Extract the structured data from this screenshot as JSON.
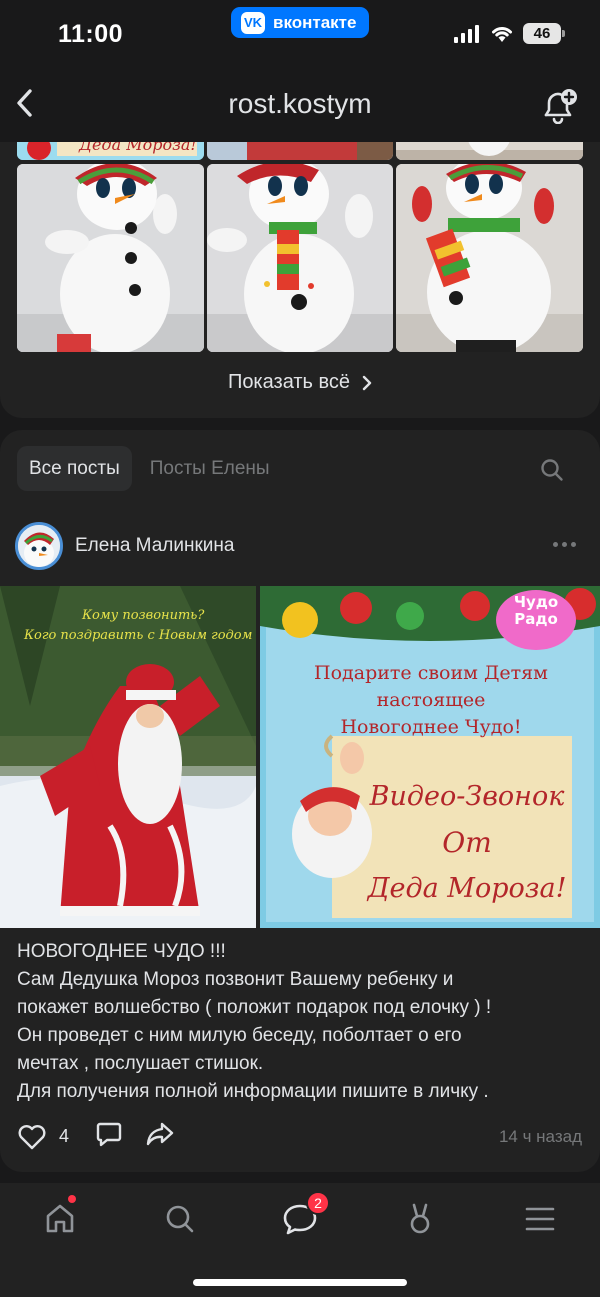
{
  "status_bar": {
    "time": "11:00",
    "app_pill_logo": "VK",
    "app_pill_label": "вконтакте",
    "battery": "46"
  },
  "header": {
    "title": "rost.kostym",
    "back_icon": "chevron-left-icon",
    "notify_icon": "bell-plus-icon"
  },
  "gallery": {
    "strip_caption": "Деда Мороза!",
    "show_all_label": "Показать всё",
    "show_all_icon": "chevron-right-icon"
  },
  "posts": {
    "tabs": [
      {
        "label": "Все посты",
        "active": true
      },
      {
        "label": "Посты Елены",
        "active": false
      }
    ],
    "post": {
      "author": "Елена Малинкина",
      "image_left_text": [
        "Кому позвонить?",
        "Кого поздравить с Новым годом !?"
      ],
      "image_right_text": {
        "logo_line1": "Чудо",
        "logo_line2": "Радо",
        "headline": [
          "Подарите своим Детям",
          "настоящее",
          "Новогоднее Чудо!"
        ],
        "scroll": [
          "Видео-Звонок",
          "От",
          "Деда Мороза!"
        ]
      },
      "text_lines": [
        "НОВОГОДНЕЕ ЧУДО !!!",
        "Сам Дедушка Мороз позвонит Вашему ребенку и",
        "покажет волшебство ( положит подарок под елочку )  !",
        "Он проведет с ним милую беседу, поболтает о его",
        "мечтах , послушает стишок.",
        "Для получения полной информации пишите в личку ."
      ],
      "likes": "4",
      "time": "14 ч назад"
    }
  },
  "bottom_nav": {
    "items": [
      "home-icon",
      "search-icon",
      "messages-icon",
      "clips-icon",
      "menu-icon"
    ],
    "messages_badge": "2"
  },
  "colors": {
    "background": "#19191a",
    "card": "#222222",
    "accent": "#0077ff",
    "badge": "#ff3347"
  }
}
